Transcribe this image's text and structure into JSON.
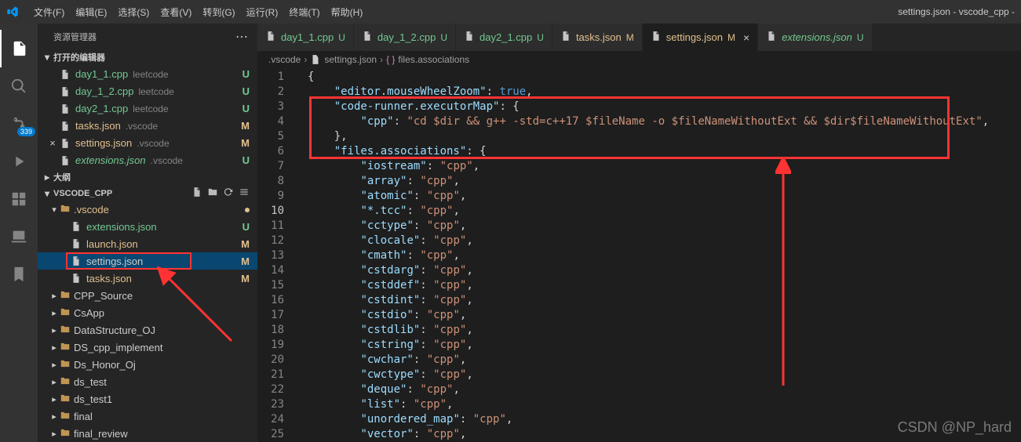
{
  "window_title": "settings.json - vscode_cpp -",
  "menu": [
    "文件(F)",
    "编辑(E)",
    "选择(S)",
    "查看(V)",
    "转到(G)",
    "运行(R)",
    "终端(T)",
    "帮助(H)"
  ],
  "scm_badge": "339",
  "explorer": {
    "title": "资源管理器",
    "open_editors_label": "打开的编辑器",
    "outline_label": "大纲",
    "project_label": "VSCODE_CPP",
    "open_editors": [
      {
        "name": "day1_1.cpp",
        "hint": "leetcode",
        "status": "U"
      },
      {
        "name": "day_1_2.cpp",
        "hint": "leetcode",
        "status": "U"
      },
      {
        "name": "day2_1.cpp",
        "hint": "leetcode",
        "status": "U"
      },
      {
        "name": "tasks.json",
        "hint": ".vscode",
        "status": "M"
      },
      {
        "name": "settings.json",
        "hint": ".vscode",
        "status": "M",
        "active": true
      },
      {
        "name": "extensions.json",
        "hint": ".vscode",
        "status": "U",
        "italic": true
      }
    ],
    "tree": {
      "vscode_folder": ".vscode",
      "vscode_files": [
        {
          "name": "extensions.json",
          "status": "U"
        },
        {
          "name": "launch.json",
          "status": "M"
        },
        {
          "name": "settings.json",
          "status": "M",
          "selected": true
        },
        {
          "name": "tasks.json",
          "status": "M"
        }
      ],
      "folders": [
        "CPP_Source",
        "CsApp",
        "DataStructure_OJ",
        "DS_cpp_implement",
        "Ds_Honor_Oj",
        "ds_test",
        "ds_test1",
        "final",
        "final_review"
      ]
    }
  },
  "tabs": [
    {
      "name": "day1_1.cpp",
      "status": "U"
    },
    {
      "name": "day_1_2.cpp",
      "status": "U"
    },
    {
      "name": "day2_1.cpp",
      "status": "U"
    },
    {
      "name": "tasks.json",
      "status": "M"
    },
    {
      "name": "settings.json",
      "status": "M",
      "active": true
    },
    {
      "name": "extensions.json",
      "status": "U",
      "italic": true
    }
  ],
  "breadcrumb": [
    ".vscode",
    "settings.json",
    "files.associations"
  ],
  "code": {
    "k_editor": "\"editor.mouseWheelZoom\"",
    "v_true": "true",
    "k_runner": "\"code-runner.executorMap\"",
    "k_cpp": "\"cpp\"",
    "v_cppcmd": "\"cd $dir && g++ -std=c++17 $fileName -o $fileNameWithoutExt && $dir$fileNameWithoutExt\"",
    "k_files": "\"files.associations\"",
    "assoc": [
      [
        "\"iostream\"",
        "\"cpp\""
      ],
      [
        "\"array\"",
        "\"cpp\""
      ],
      [
        "\"atomic\"",
        "\"cpp\""
      ],
      [
        "\"*.tcc\"",
        "\"cpp\""
      ],
      [
        "\"cctype\"",
        "\"cpp\""
      ],
      [
        "\"clocale\"",
        "\"cpp\""
      ],
      [
        "\"cmath\"",
        "\"cpp\""
      ],
      [
        "\"cstdarg\"",
        "\"cpp\""
      ],
      [
        "\"cstddef\"",
        "\"cpp\""
      ],
      [
        "\"cstdint\"",
        "\"cpp\""
      ],
      [
        "\"cstdio\"",
        "\"cpp\""
      ],
      [
        "\"cstdlib\"",
        "\"cpp\""
      ],
      [
        "\"cstring\"",
        "\"cpp\""
      ],
      [
        "\"cwchar\"",
        "\"cpp\""
      ],
      [
        "\"cwctype\"",
        "\"cpp\""
      ],
      [
        "\"deque\"",
        "\"cpp\""
      ],
      [
        "\"list\"",
        "\"cpp\""
      ],
      [
        "\"unordered_map\"",
        "\"cpp\""
      ],
      [
        "\"vector\"",
        "\"cpp\""
      ]
    ]
  },
  "watermark": "CSDN @NP_hard"
}
